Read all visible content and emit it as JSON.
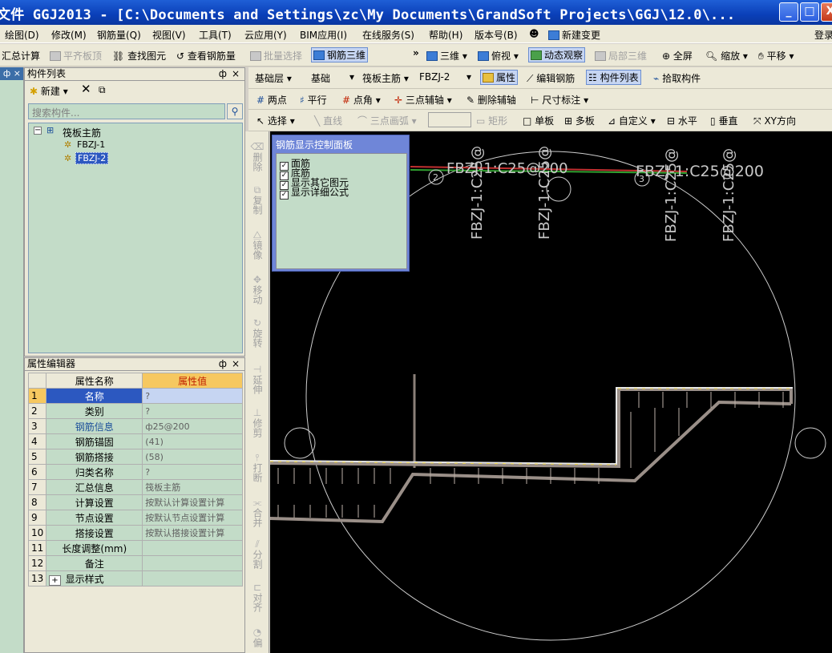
{
  "window": {
    "title": "文件 GGJ2013 - [C:\\Documents and Settings\\zc\\My Documents\\GrandSoft Projects\\GGJ\\12.0\\...",
    "buttons": [
      "_",
      "□",
      "X"
    ]
  },
  "menu": {
    "items": [
      "绘图(D)",
      "修改(M)",
      "钢筋量(Q)",
      "视图(V)",
      "工具(T)",
      "云应用(Y)",
      "BIM应用(I)",
      "在线服务(S)",
      "帮助(H)",
      "版本号(B)",
      "新建变更"
    ],
    "login": "登录"
  },
  "toolbar1": {
    "items": [
      "汇总计算",
      "平齐板顶",
      "查找图元",
      "查看钢筋量",
      "批量选择",
      "钢筋三维",
      "»",
      "三维",
      "俯视",
      "动态观察",
      "局部三维",
      "全屏",
      "缩放",
      "平移"
    ]
  },
  "toolbar2": {
    "floor": "基础层",
    "category": "基础",
    "type": "筏板主筋",
    "element": "FBZJ-2",
    "buttons": [
      "属性",
      "编辑钢筋",
      "构件列表",
      "拾取构件"
    ]
  },
  "toolbar3": {
    "items": [
      "两点",
      "平行",
      "点角",
      "三点辅轴",
      "删除辅轴",
      "尺寸标注"
    ]
  },
  "toolbar4": {
    "items": [
      "选择",
      "直线",
      "三点画弧",
      "矩形",
      "单板",
      "多板",
      "自定义",
      "水平",
      "垂直",
      "XY方向"
    ]
  },
  "left_strip": {
    "pin": "ф",
    "close": "×"
  },
  "component_list": {
    "title": "构件列表",
    "new_label": "新建",
    "search_placeholder": "搜索构件...",
    "tree_root": "筏板主筋",
    "tree_items": [
      "FBZJ-1",
      "FBZJ-2"
    ],
    "selected": "FBZJ-2"
  },
  "property_editor": {
    "title": "属性编辑器",
    "col_name": "属性名称",
    "col_value": "属性值",
    "rows": [
      {
        "no": "1",
        "name": "名称",
        "value": "?"
      },
      {
        "no": "2",
        "name": "类别",
        "value": "?"
      },
      {
        "no": "3",
        "name": "钢筋信息",
        "value": "ф25@200"
      },
      {
        "no": "4",
        "name": "钢筋锚固",
        "value": "(41)"
      },
      {
        "no": "5",
        "name": "钢筋搭接",
        "value": "(58)"
      },
      {
        "no": "6",
        "name": "归类名称",
        "value": "?"
      },
      {
        "no": "7",
        "name": "汇总信息",
        "value": "筏板主筋"
      },
      {
        "no": "8",
        "name": "计算设置",
        "value": "按默认计算设置计算"
      },
      {
        "no": "9",
        "name": "节点设置",
        "value": "按默认节点设置计算"
      },
      {
        "no": "10",
        "name": "搭接设置",
        "value": "按默认搭接设置计算"
      },
      {
        "no": "11",
        "name": "长度调整(mm)",
        "value": ""
      },
      {
        "no": "12",
        "name": "备注",
        "value": ""
      },
      {
        "no": "13",
        "name": "显示样式",
        "value": ""
      }
    ]
  },
  "vertical_tools": [
    "删除",
    "复制",
    "镜像",
    "移动",
    "旋转",
    "延伸",
    "修剪",
    "打断",
    "合并",
    "分割",
    "对齐",
    "偏"
  ],
  "control_panel": {
    "title": "钢筋显示控制面板",
    "options": [
      "面筋",
      "底筋",
      "显示其它图元",
      "显示详细公式"
    ]
  },
  "canvas": {
    "labels_horizontal": [
      "FBZJ-1:C25@200",
      "FBZJ-1:C25@200"
    ],
    "labels_vertical": [
      "FBZJ-1:C25@",
      "FBZJ-1:C25@",
      "FBZJ-1:C25@",
      "FBZJ-1:C25@"
    ],
    "markers": [
      "2",
      "3"
    ]
  }
}
